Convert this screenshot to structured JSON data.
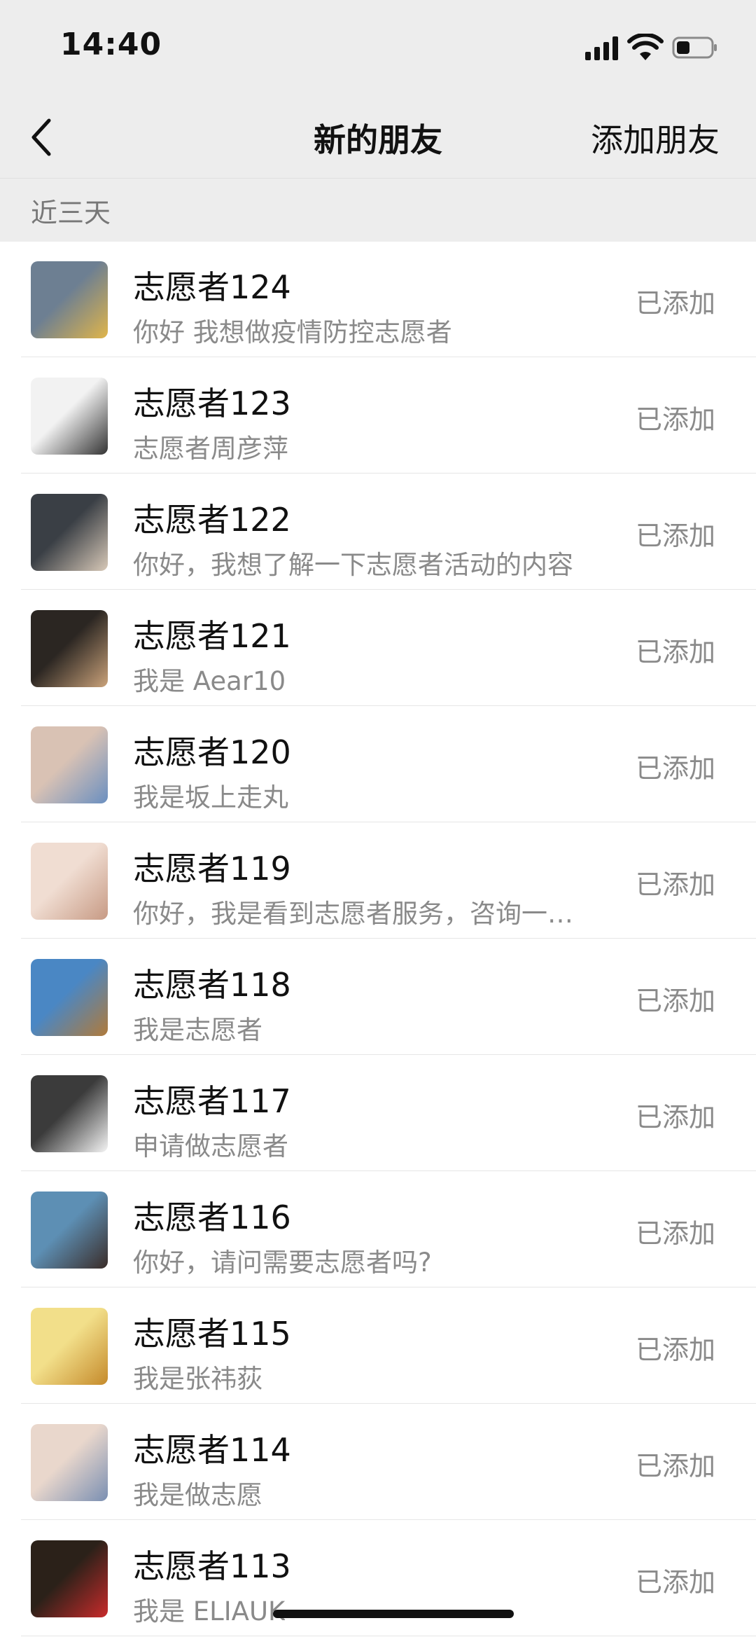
{
  "status_bar": {
    "time": "14:40"
  },
  "nav": {
    "title": "新的朋友",
    "action": "添加朋友"
  },
  "section_label": "近三天",
  "rows": [
    {
      "name": "志愿者124",
      "message": "你好 我想做疫情防控志愿者",
      "status": "已添加"
    },
    {
      "name": "志愿者123",
      "message": "志愿者周彦萍",
      "status": "已添加"
    },
    {
      "name": "志愿者122",
      "message": "你好，我想了解一下志愿者活动的内容",
      "status": "已添加"
    },
    {
      "name": "志愿者121",
      "message": "我是 Aear10",
      "status": "已添加"
    },
    {
      "name": "志愿者120",
      "message": "我是坂上走丸",
      "status": "已添加"
    },
    {
      "name": "志愿者119",
      "message": "你好，我是看到志愿者服务，咨询一…",
      "status": "已添加"
    },
    {
      "name": "志愿者118",
      "message": "我是志愿者",
      "status": "已添加"
    },
    {
      "name": "志愿者117",
      "message": "申请做志愿者",
      "status": "已添加"
    },
    {
      "name": "志愿者116",
      "message": "你好，请问需要志愿者吗?",
      "status": "已添加"
    },
    {
      "name": "志愿者115",
      "message": "我是张祎荻",
      "status": "已添加"
    },
    {
      "name": "志愿者114",
      "message": "我是做志愿",
      "status": "已添加"
    },
    {
      "name": "志愿者113",
      "message": "我是 ELIAUK",
      "status": "已添加"
    }
  ],
  "avatar_colors": [
    [
      "#6d7f92",
      "#e0b54a"
    ],
    [
      "#f2f2f2",
      "#333333"
    ],
    [
      "#3a3f45",
      "#d8c9b8"
    ],
    [
      "#2b2622",
      "#caa27a"
    ],
    [
      "#d9c2b4",
      "#6a8fc0"
    ],
    [
      "#f0ddd2",
      "#c79a84"
    ],
    [
      "#4a87c4",
      "#b07a3a"
    ],
    [
      "#3b3b3b",
      "#f5f5f5"
    ],
    [
      "#5d8fb4",
      "#3a2c28"
    ],
    [
      "#f2df8a",
      "#c58a2b"
    ],
    [
      "#e9d7cc",
      "#7a8fb2"
    ],
    [
      "#2b2119",
      "#c92b2b"
    ]
  ]
}
